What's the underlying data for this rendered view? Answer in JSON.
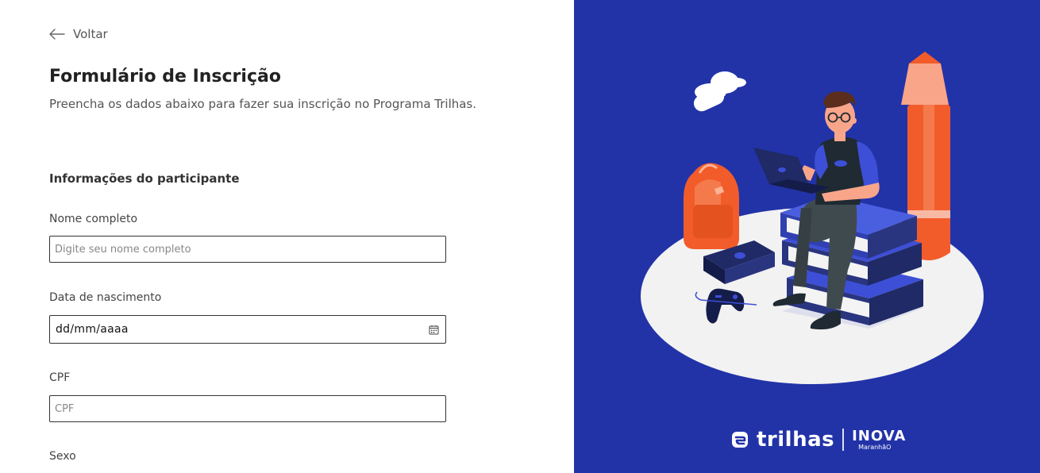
{
  "nav": {
    "back_label": "Voltar"
  },
  "form": {
    "title": "Formulário de Inscrição",
    "subtitle": "Preencha os dados abaixo para fazer sua inscrição no Programa Trilhas.",
    "section_title": "Informações do participante",
    "fields": {
      "name": {
        "label": "Nome completo",
        "placeholder": "Digite seu nome completo"
      },
      "birthdate": {
        "label": "Data de nascimento",
        "value": "dd/mm/aaaa"
      },
      "cpf": {
        "label": "CPF",
        "placeholder": "CPF"
      },
      "sex": {
        "label": "Sexo"
      }
    }
  },
  "brand": {
    "trilhas": "trilhas",
    "inova": "INOVA",
    "inova_sub": "MaranhãO"
  },
  "colors": {
    "panel_bg": "#2233a8",
    "accent_orange": "#f25c2a",
    "book_blue": "#3d4fd6"
  },
  "icons": [
    "arrow-left-icon",
    "calendar-icon",
    "trilhas-logo-icon"
  ]
}
